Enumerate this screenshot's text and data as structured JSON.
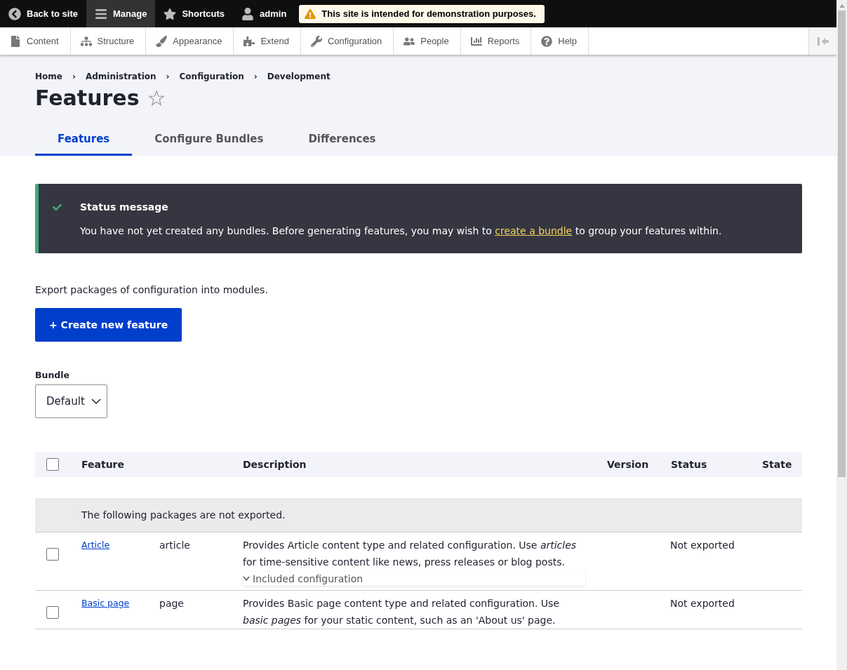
{
  "toolbar": {
    "items": [
      {
        "kind": "back",
        "label": "Back to site",
        "selected": false
      },
      {
        "kind": "menu",
        "label": "Manage",
        "selected": true
      },
      {
        "kind": "star",
        "label": "Shortcuts",
        "selected": false
      },
      {
        "kind": "user",
        "label": "admin",
        "selected": false
      }
    ],
    "notice": "This site is intended for demonstration purposes."
  },
  "admin_menu": [
    {
      "kind": "file",
      "label": "Content"
    },
    {
      "kind": "tree",
      "label": "Structure"
    },
    {
      "kind": "brush",
      "label": "Appearance"
    },
    {
      "kind": "puzzle",
      "label": "Extend"
    },
    {
      "kind": "wrench",
      "label": "Configuration"
    },
    {
      "kind": "people",
      "label": "People"
    },
    {
      "kind": "bars",
      "label": "Reports"
    },
    {
      "kind": "help",
      "label": "Help"
    }
  ],
  "breadcrumb": [
    "Home",
    "Administration",
    "Configuration",
    "Development"
  ],
  "separator": "›",
  "page_title": "Features",
  "tabs": [
    {
      "label": "Features",
      "selected": true
    },
    {
      "label": "Configure Bundles",
      "selected": false
    },
    {
      "label": "Differences",
      "selected": false
    }
  ],
  "status": {
    "title": "Status message",
    "before": "You have not yet created any bundles. Before generating features, you may wish to",
    "link": "create a bundle",
    "after": "to group your features within."
  },
  "intro": "Export packages of configuration into modules.",
  "create_button": "+ Create new feature",
  "bundle": {
    "label": "Bundle",
    "value": "Default"
  },
  "table": {
    "select_all_checked": false,
    "columns": [
      "Feature",
      "Description",
      "Version",
      "Status",
      "State"
    ],
    "group": "The following packages are not exported.",
    "rows": [
      {
        "checked": false,
        "name": "Article",
        "machine": "article",
        "description": "Provides Article content type and related configuration. Use *articles* for time-sensitive content like news, press releases or blog posts.",
        "details": "Included configuration",
        "status": "Not exported"
      },
      {
        "checked": false,
        "name": "Basic page",
        "machine": "page",
        "description": "Provides Basic page content type and related configuration. Use *basic pages* for your static content, such as an 'About us' page.",
        "status": "Not exported"
      }
    ]
  }
}
